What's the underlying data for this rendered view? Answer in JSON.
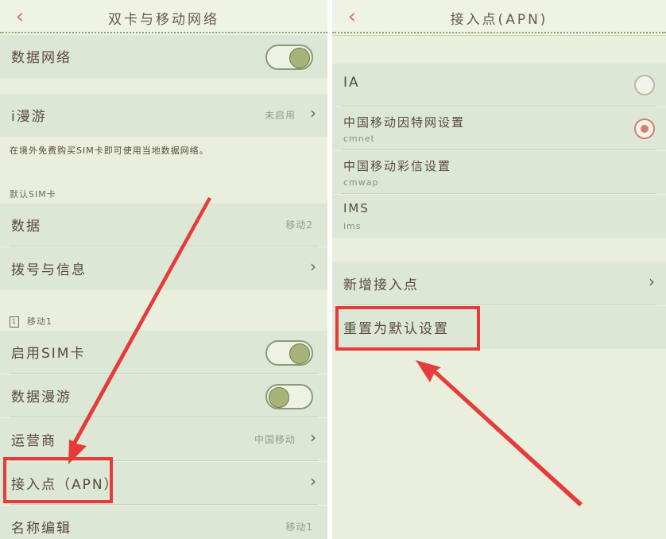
{
  "left": {
    "title": "双卡与移动网络",
    "data_network_label": "数据网络",
    "roaming_label": "i漫游",
    "roaming_value": "未启用",
    "roaming_note": "在境外免费购买SIM卡即可使用当地数据网络。",
    "default_sim_section": "默认SIM卡",
    "data_label": "数据",
    "data_value": "移动2",
    "dial_label": "拨号与信息",
    "sim_section_icon": "1",
    "sim_section_label": "移动1",
    "enable_sim_label": "启用SIM卡",
    "data_roaming_label": "数据漫游",
    "carrier_label": "运营商",
    "carrier_value": "中国移动",
    "apn_label": "接入点（APN）",
    "name_edit_label": "名称编辑",
    "name_edit_value": "移动1"
  },
  "right": {
    "title": "接入点(APN)",
    "apns": [
      {
        "name": "IA",
        "sub": ""
      },
      {
        "name": "中国移动因特网设置",
        "sub": "cmnet"
      },
      {
        "name": "中国移动彩信设置",
        "sub": "cmwap"
      },
      {
        "name": "IMS",
        "sub": "ims"
      }
    ],
    "selected_apn": "中国移动因特网设置",
    "new_apn_label": "新增接入点",
    "reset_label": "重置为默认设置"
  },
  "colors": {
    "accent": "#d77d70",
    "highlight": "#e53b3b",
    "background": "#e9efdc"
  },
  "icons": {
    "back": "chevron-left-icon",
    "chevron": "chevron-right-icon",
    "sim": "sim-card-icon"
  }
}
